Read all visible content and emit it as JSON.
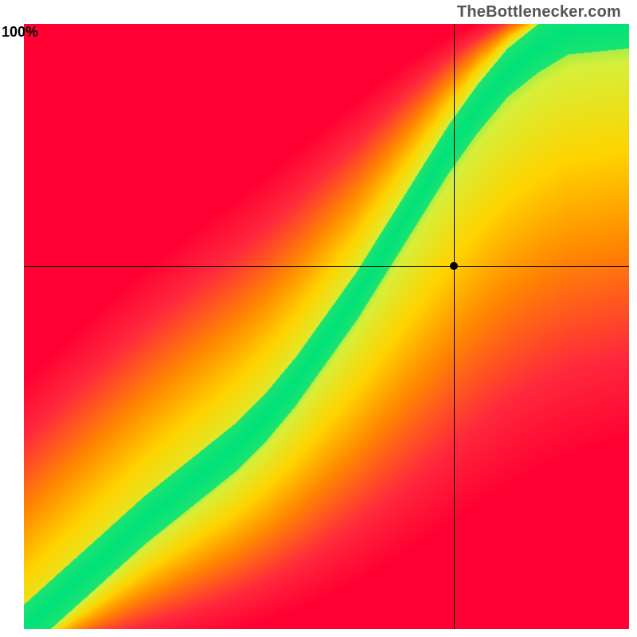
{
  "watermark": "TheBottlenecker.com",
  "ylabel": "100%",
  "chart_data": {
    "type": "heatmap",
    "title": "",
    "xlabel": "",
    "ylabel": "100%",
    "xlim": [
      0,
      100
    ],
    "ylim": [
      0,
      100
    ],
    "grid": false,
    "legend": "none",
    "description": "Bottleneck heatmap. Green ridge marks balanced pairings (0% bottleneck); color shifts toward red as bottleneck severity rises on either side of the ridge. A crosshair marks the user's selected configuration.",
    "color_stops": [
      {
        "value": 0.0,
        "color": "#00e27a",
        "meaning": "0% bottleneck"
      },
      {
        "value": 0.15,
        "color": "#d7f03a",
        "meaning": "mild"
      },
      {
        "value": 0.35,
        "color": "#ffd400",
        "meaning": "moderate"
      },
      {
        "value": 0.55,
        "color": "#ff8a00",
        "meaning": "high"
      },
      {
        "value": 0.8,
        "color": "#ff2a3c",
        "meaning": "severe"
      },
      {
        "value": 1.0,
        "color": "#ff0033",
        "meaning": "extreme"
      }
    ],
    "ridge": {
      "description": "Ideal y for each x (0-100). Curve starts linear, bulges slightly below diagonal mid-range, then steepens above diagonal toward top-right. Green band half-width ~4 units, widening slightly at higher x.",
      "points": [
        {
          "x": 0,
          "y": 0
        },
        {
          "x": 10,
          "y": 9
        },
        {
          "x": 20,
          "y": 18
        },
        {
          "x": 30,
          "y": 26
        },
        {
          "x": 35,
          "y": 30
        },
        {
          "x": 40,
          "y": 35
        },
        {
          "x": 45,
          "y": 41
        },
        {
          "x": 50,
          "y": 48
        },
        {
          "x": 55,
          "y": 55
        },
        {
          "x": 60,
          "y": 63
        },
        {
          "x": 65,
          "y": 71
        },
        {
          "x": 70,
          "y": 79
        },
        {
          "x": 75,
          "y": 86
        },
        {
          "x": 80,
          "y": 92
        },
        {
          "x": 85,
          "y": 96
        },
        {
          "x": 90,
          "y": 99
        },
        {
          "x": 100,
          "y": 100
        }
      ],
      "band_halfwidth": 4
    },
    "corner_tendency": {
      "top_left": "red",
      "bottom_left_origin": "red",
      "bottom_right": "red",
      "top_right": "yellow-orange",
      "along_ridge": "green"
    },
    "crosshair": {
      "x": 71,
      "y": 60
    },
    "marker": {
      "x": 71,
      "y": 60
    }
  }
}
